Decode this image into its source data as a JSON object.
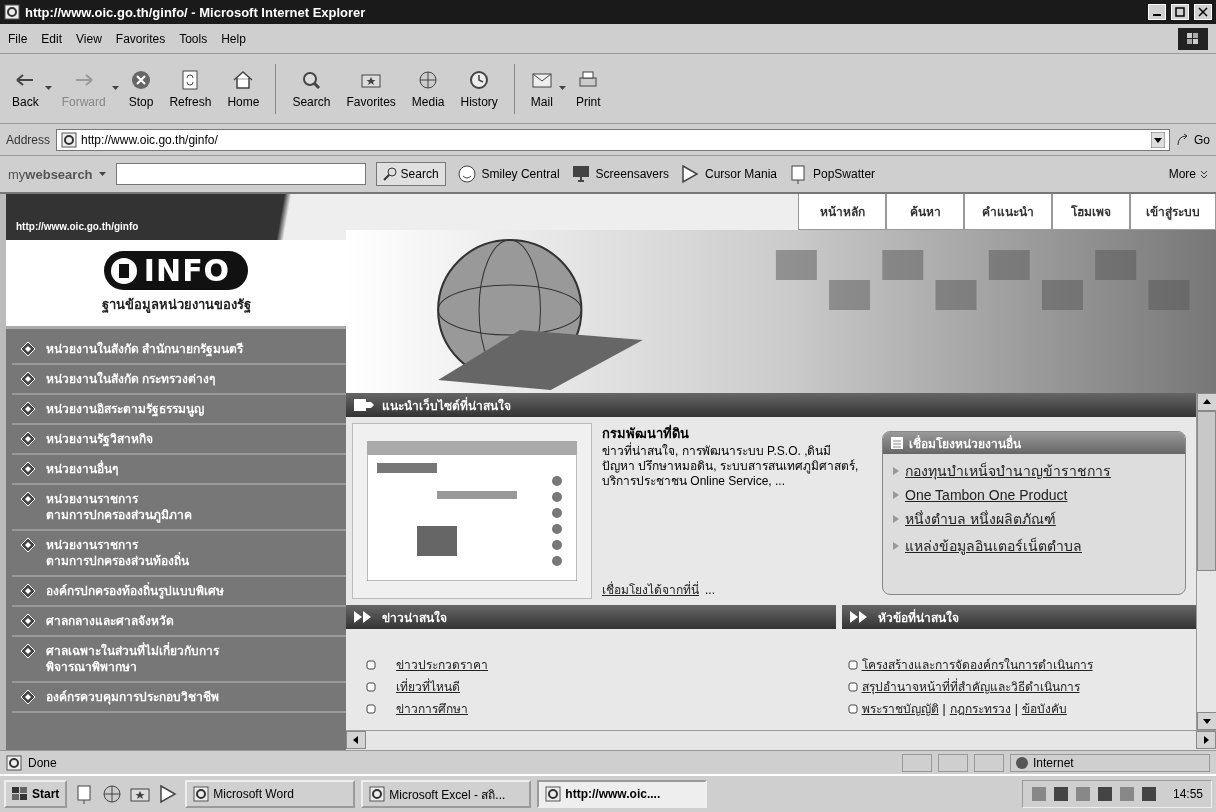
{
  "window": {
    "title": "http://www.oic.go.th/ginfo/ - Microsoft Internet Explorer"
  },
  "menu": [
    "File",
    "Edit",
    "View",
    "Favorites",
    "Tools",
    "Help"
  ],
  "toolbar": [
    {
      "kind": "back",
      "label": "Back",
      "disabled": false,
      "dropdown": true
    },
    {
      "kind": "forward",
      "label": "Forward",
      "disabled": true,
      "dropdown": true
    },
    {
      "kind": "stop",
      "label": "Stop",
      "disabled": false,
      "dropdown": false
    },
    {
      "kind": "refresh",
      "label": "Refresh",
      "disabled": false,
      "dropdown": false
    },
    {
      "kind": "home",
      "label": "Home",
      "disabled": false,
      "dropdown": false
    },
    {
      "kind": "search",
      "label": "Search",
      "disabled": false,
      "dropdown": false
    },
    {
      "kind": "favorites",
      "label": "Favorites",
      "disabled": false,
      "dropdown": false
    },
    {
      "kind": "media",
      "label": "Media",
      "disabled": false,
      "dropdown": false
    },
    {
      "kind": "history",
      "label": "History",
      "disabled": false,
      "dropdown": false
    },
    {
      "kind": "mail",
      "label": "Mail",
      "disabled": false,
      "dropdown": true
    },
    {
      "kind": "print",
      "label": "Print",
      "disabled": false,
      "dropdown": false
    }
  ],
  "address": {
    "label": "Address",
    "value": "http://www.oic.go.th/ginfo/",
    "go": "Go"
  },
  "search_bar": {
    "brand": "my**websearch**",
    "search_button": "Search",
    "links": [
      {
        "kind": "smiley",
        "label": "Smiley Central"
      },
      {
        "kind": "monitor",
        "label": "Screensavers"
      },
      {
        "kind": "cursor",
        "label": "Cursor Mania"
      },
      {
        "kind": "window",
        "label": "PopSwatter"
      }
    ],
    "more": "More"
  },
  "site": {
    "url_banner": "http://www.oic.go.th/ginfo",
    "logo": "INFO",
    "logo_subtitle": "ฐานข้อมูลหน่วยงานของรัฐ",
    "nav": [
      "หน้าหลัก",
      "ค้นหา",
      "คำแนะนำ",
      "โฮมเพจ",
      "เข้าสู่ระบบ"
    ],
    "sidebar": [
      "หน่วยงานในสังกัด สำนักนายกรัฐมนตรี",
      "หน่วยงานในสังกัด กระทรวงต่างๆ",
      "หน่วยงานอิสระตามรัฐธรรมนูญ",
      "หน่วยงานรัฐวิสาหกิจ",
      "หน่วยงานอื่นๆ",
      "หน่วยงานราชการ\nตามการปกครองส่วนภูมิภาค",
      "หน่วยงานราชการ\nตามการปกครองส่วนท้องถิ่น",
      "องค์กรปกครองท้องถิ่นรูปแบบพิเศษ",
      "ศาลกลางและศาลจังหวัด",
      "ศาลเฉพาะในส่วนที่ไม่เกี่ยวกับการ\nพิจารณาพิพากษา",
      "องค์กรควบคุมการประกอบวิชาชีพ"
    ],
    "featured": {
      "heading": "แนะนำเว็บไซต์ที่น่าสนใจ",
      "title": "กรมพัฒนาที่ดิน",
      "description": "ข่าวที่น่าสนใจ, การพัฒนาระบบ P.S.O. ,ดินมีปัญหา ปรึกษาหมอดิน, ระบบสารสนเทศภูมิศาสตร์, บริการประชาชน Online Service, ...",
      "link": "เชื่อมโยงได้จากที่นี่",
      "link_suffix": "..."
    },
    "links_box": {
      "title": "เชื่อมโยงหน่วยงานอื่น",
      "items": [
        "กองทุนบำเหน็จบำนาญข้าราชการ",
        "One Tambon One Product",
        "หนึ่งตำบล หนึ่งผลิตภัณฑ์",
        "แหล่งข้อมูลอินเตอร์เน็ตตำบล"
      ]
    },
    "news": {
      "heading": "ข่าวน่าสนใจ",
      "items": [
        "ข่าวประกวดราคา",
        "เที่ยวที่ไหนดี",
        "ข่าวการศึกษา"
      ]
    },
    "topics": {
      "heading": "หัวข้อที่น่าสนใจ",
      "items": [
        [
          "โครงสร้างและการจัดองค์กรในการดำเนินการ"
        ],
        [
          "สรุปอำนาจหน้าที่ที่สำคัญและวิธีดำเนินการ"
        ],
        [
          "พระราชบัญญัติ",
          "กฎกระทรวง",
          "ข้อบังคับ"
        ]
      ],
      "separator": "|"
    }
  },
  "status_bar": {
    "text": "Done",
    "zone": "Internet"
  },
  "taskbar": {
    "start": "Start",
    "tasks": [
      {
        "label": "Microsoft Word",
        "selected": false
      },
      {
        "label": "Microsoft Excel - สถิ...",
        "selected": false
      },
      {
        "label": "http://www.oic....",
        "selected": true
      }
    ],
    "clock": "14:55"
  }
}
